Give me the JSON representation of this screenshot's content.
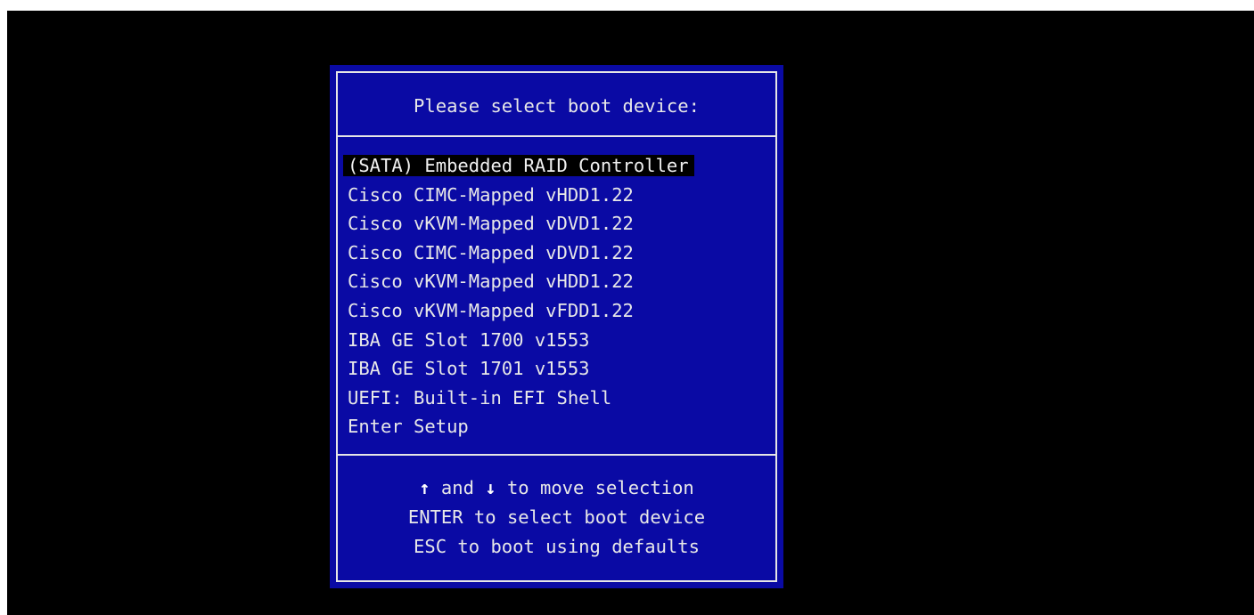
{
  "boot_menu": {
    "title": "Please select boot device:",
    "selected_index": 0,
    "devices": [
      "(SATA) Embedded RAID Controller",
      "Cisco CIMC-Mapped vHDD1.22",
      "Cisco vKVM-Mapped vDVD1.22",
      "Cisco CIMC-Mapped vDVD1.22",
      "Cisco vKVM-Mapped vHDD1.22",
      "Cisco vKVM-Mapped vFDD1.22",
      "IBA GE Slot 1700 v1553",
      "IBA GE Slot 1701 v1553",
      "UEFI: Built-in EFI Shell",
      "Enter Setup"
    ],
    "help": {
      "up_arrow": "↑",
      "and_text": " and ",
      "down_arrow": "↓",
      "move_text": " to move selection",
      "enter_line": "ENTER to select boot device",
      "esc_line": "ESC to boot using defaults"
    },
    "colors": {
      "panel_background": "#0a0aa4",
      "screen_background": "#000000",
      "text": "#e8e8e8",
      "highlight": "#000000"
    }
  }
}
